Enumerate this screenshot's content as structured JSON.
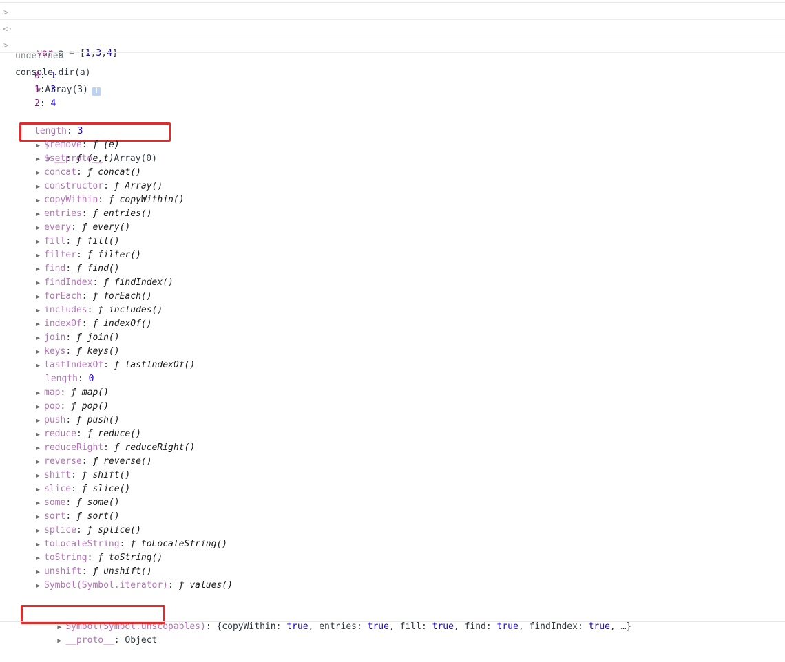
{
  "console": {
    "input1": {
      "kw": "var",
      "code": " a = [",
      "n1": "1",
      "c1": ",",
      "n2": "3",
      "c2": ",",
      "n3": "4",
      "end": "]"
    },
    "output1": "undefined",
    "input2": "console.dir(a)",
    "array_header": "Array(3)",
    "info_glyph": "i",
    "items": [
      {
        "key": "0",
        "value": "1"
      },
      {
        "key": "1",
        "value": "3"
      },
      {
        "key": "2",
        "value": "4"
      }
    ],
    "length": {
      "key": "length",
      "value": "3"
    },
    "proto": {
      "key": "__proto__",
      "value": "Array(0)"
    },
    "methods": [
      {
        "key": "$remove",
        "value": "ƒ (e)"
      },
      {
        "key": "$set",
        "value": "ƒ (e,t)"
      },
      {
        "key": "concat",
        "value": "ƒ concat()"
      },
      {
        "key": "constructor",
        "value": "ƒ Array()"
      },
      {
        "key": "copyWithin",
        "value": "ƒ copyWithin()"
      },
      {
        "key": "entries",
        "value": "ƒ entries()"
      },
      {
        "key": "every",
        "value": "ƒ every()"
      },
      {
        "key": "fill",
        "value": "ƒ fill()"
      },
      {
        "key": "filter",
        "value": "ƒ filter()"
      },
      {
        "key": "find",
        "value": "ƒ find()"
      },
      {
        "key": "findIndex",
        "value": "ƒ findIndex()"
      },
      {
        "key": "forEach",
        "value": "ƒ forEach()"
      },
      {
        "key": "includes",
        "value": "ƒ includes()"
      },
      {
        "key": "indexOf",
        "value": "ƒ indexOf()"
      },
      {
        "key": "join",
        "value": "ƒ join()"
      },
      {
        "key": "keys",
        "value": "ƒ keys()"
      },
      {
        "key": "lastIndexOf",
        "value": "ƒ lastIndexOf()"
      },
      {
        "key": "length",
        "value": "0",
        "plain": true
      },
      {
        "key": "map",
        "value": "ƒ map()"
      },
      {
        "key": "pop",
        "value": "ƒ pop()"
      },
      {
        "key": "push",
        "value": "ƒ push()"
      },
      {
        "key": "reduce",
        "value": "ƒ reduce()"
      },
      {
        "key": "reduceRight",
        "value": "ƒ reduceRight()"
      },
      {
        "key": "reverse",
        "value": "ƒ reverse()"
      },
      {
        "key": "shift",
        "value": "ƒ shift()"
      },
      {
        "key": "slice",
        "value": "ƒ slice()"
      },
      {
        "key": "some",
        "value": "ƒ some()"
      },
      {
        "key": "sort",
        "value": "ƒ sort()"
      },
      {
        "key": "splice",
        "value": "ƒ splice()"
      },
      {
        "key": "toLocaleString",
        "value": "ƒ toLocaleString()"
      },
      {
        "key": "toString",
        "value": "ƒ toString()"
      },
      {
        "key": "unshift",
        "value": "ƒ unshift()"
      },
      {
        "key": "Symbol(Symbol.iterator)",
        "value": "ƒ values()"
      }
    ],
    "unscopables": {
      "key": "Symbol(Symbol.unscopables)",
      "open": "{",
      "pairs": [
        {
          "k": "copyWithin",
          "v": "true"
        },
        {
          "k": "entries",
          "v": "true"
        },
        {
          "k": "fill",
          "v": "true"
        },
        {
          "k": "find",
          "v": "true"
        },
        {
          "k": "findIndex",
          "v": "true"
        }
      ],
      "ellipsis": "…}"
    },
    "proto2": {
      "key": "__proto__",
      "value": "Object"
    }
  },
  "highlight_color": "#e22b2b"
}
